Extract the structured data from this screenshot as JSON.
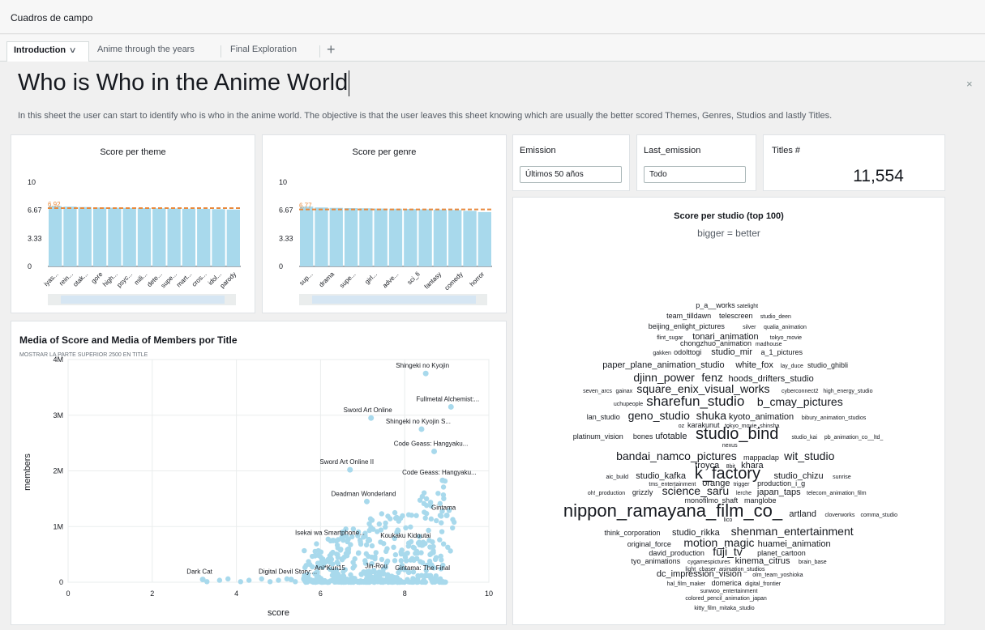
{
  "app": {
    "title": "Cuadros de campo"
  },
  "tabs": [
    {
      "label": "Introduction"
    },
    {
      "label": "Anime through the years"
    },
    {
      "label": "Final Exploration"
    }
  ],
  "sheet": {
    "title": "Who is Who in the Anime World",
    "description": "In this sheet the user can start to identify who is who in the anime world. The objective is that the user leaves this sheet knowing which are usually the better scored Themes, Genres, Studios and lastly Titles."
  },
  "controls": {
    "emission": {
      "label": "Emission",
      "value": "Últimos 50 años"
    },
    "last_emission": {
      "label": "Last_emission",
      "value": "Todo"
    }
  },
  "kpi": {
    "label": "Titles #",
    "value": "11,554"
  },
  "colors": {
    "bar": "#a8d9ec",
    "reference": "#e8893c",
    "point": "#a8d9ec",
    "wordcloud": "#16191f"
  },
  "chart_data": [
    {
      "type": "bar",
      "title": "Score per theme",
      "ylim": [
        0,
        10
      ],
      "yticks": [
        "0",
        "3.33",
        "6.67",
        "10"
      ],
      "reference_label": "6.92",
      "reference_value": 6.92,
      "categories": [
        "iyas...",
        "rein...",
        "otak...",
        "gore",
        "high...",
        "psyc...",
        "mili...",
        "dete...",
        "supe...",
        "mart...",
        "cros...",
        "idol...",
        "parody"
      ],
      "values": [
        7.15,
        7.1,
        7.05,
        7.0,
        6.97,
        6.95,
        6.92,
        6.9,
        6.88,
        6.86,
        6.84,
        6.8,
        6.75
      ],
      "grid": false
    },
    {
      "type": "bar",
      "title": "Score per genre",
      "ylim": [
        0,
        10
      ],
      "yticks": [
        "0",
        "3.33",
        "6.67",
        "10"
      ],
      "reference_label": "6.77",
      "reference_value": 6.77,
      "categories": [
        "sup...",
        "drama",
        "supe...",
        "girl...",
        "adve...",
        "sci_fi",
        "fantasy",
        "comedy",
        "horror"
      ],
      "values": [
        7.1,
        7.0,
        6.95,
        6.92,
        6.9,
        6.87,
        6.85,
        6.82,
        6.78,
        6.75,
        6.7,
        6.6,
        6.45
      ],
      "grid": false
    },
    {
      "type": "scatter",
      "title": "Media of Score and Media of Members por Title",
      "subtitle": "MOSTRAR LA PARTE SUPERIOR 2500 EN TITLE",
      "xlabel": "score",
      "ylabel": "members",
      "xlim": [
        0,
        10
      ],
      "ylim": [
        0,
        4000000
      ],
      "xticks": [
        "0",
        "2",
        "4",
        "6",
        "8",
        "10"
      ],
      "yticks": [
        "0",
        "1M",
        "2M",
        "3M",
        "4M"
      ],
      "labeled_points": [
        {
          "label": "Shingeki no Kyojin",
          "x": 8.5,
          "y": 3750000
        },
        {
          "label": "Fullmetal Alchemist:...",
          "x": 9.1,
          "y": 3150000
        },
        {
          "label": "Sword Art Online",
          "x": 7.2,
          "y": 2950000
        },
        {
          "label": "Shingeki no Kyojin S...",
          "x": 8.4,
          "y": 2750000
        },
        {
          "label": "Code Geass: Hangyaku...",
          "x": 8.7,
          "y": 2350000
        },
        {
          "label": "Sword Art Online II",
          "x": 6.7,
          "y": 2020000
        },
        {
          "label": "Code Geass: Hangyaku...",
          "x": 8.9,
          "y": 1830000
        },
        {
          "label": "Deadman Wonderland",
          "x": 7.1,
          "y": 1450000
        },
        {
          "label": "Gintama",
          "x": 9.0,
          "y": 1200000
        },
        {
          "label": "Isekai wa Smartphone...",
          "x": 6.3,
          "y": 750000
        },
        {
          "label": "Koukaku Kidoutai",
          "x": 8.1,
          "y": 700000
        },
        {
          "label": "Dark Cat",
          "x": 3.2,
          "y": 50000
        },
        {
          "label": "Digital Devil Story:...",
          "x": 5.3,
          "y": 50000
        },
        {
          "label": "Ani*Kuri15",
          "x": 6.3,
          "y": 120000
        },
        {
          "label": "Jin-Rou",
          "x": 7.4,
          "y": 150000
        },
        {
          "label": "Gintama: The Final",
          "x": 8.5,
          "y": 120000
        }
      ],
      "grid": true
    },
    {
      "type": "wordcloud",
      "title": "Score per studio (top 100)",
      "subtitle": "bigger = better",
      "words": [
        {
          "text": "p_a__works",
          "w": 1
        },
        {
          "text": "satelight",
          "w": 0
        },
        {
          "text": "team_tilldawn",
          "w": 1
        },
        {
          "text": "telescreen",
          "w": 1
        },
        {
          "text": "studio_deen",
          "w": 0
        },
        {
          "text": "beijing_enlight_pictures",
          "w": 1
        },
        {
          "text": "silver",
          "w": 0
        },
        {
          "text": "qualia_animation",
          "w": 0
        },
        {
          "text": "flint_sugar",
          "w": 0
        },
        {
          "text": "tonari_animation",
          "w": 2
        },
        {
          "text": "tokyo_movie",
          "w": 0
        },
        {
          "text": "chongzhuo_animation",
          "w": 1
        },
        {
          "text": "madhouse",
          "w": 0
        },
        {
          "text": "gakken",
          "w": 0
        },
        {
          "text": "odolttogi",
          "w": 1
        },
        {
          "text": "studio_mir",
          "w": 2
        },
        {
          "text": "a_1_pictures",
          "w": 1
        },
        {
          "text": "paper_plane_animation_studio",
          "w": 2
        },
        {
          "text": "white_fox",
          "w": 2
        },
        {
          "text": "lay_duce",
          "w": 0
        },
        {
          "text": "studio_ghibli",
          "w": 1
        },
        {
          "text": "djinn_power",
          "w": 3
        },
        {
          "text": "fenz",
          "w": 3
        },
        {
          "text": "hoods_drifters_studio",
          "w": 2
        },
        {
          "text": "seven_arcs",
          "w": 0
        },
        {
          "text": "gainax",
          "w": 0
        },
        {
          "text": "square_enix_visual_works",
          "w": 3
        },
        {
          "text": "cyberconnect2",
          "w": 0
        },
        {
          "text": "high_energy_studio",
          "w": 0
        },
        {
          "text": "uchupeople",
          "w": 0
        },
        {
          "text": "sharefun_studio",
          "w": 4
        },
        {
          "text": "b_cmay_pictures",
          "w": 3
        },
        {
          "text": "lan_studio",
          "w": 1
        },
        {
          "text": "geno_studio",
          "w": 3
        },
        {
          "text": "shuka",
          "w": 3
        },
        {
          "text": "kyoto_animation",
          "w": 2
        },
        {
          "text": "bibury_animation_studios",
          "w": 0
        },
        {
          "text": "oz",
          "w": 0
        },
        {
          "text": "karakunut",
          "w": 1
        },
        {
          "text": "tokyo_movie_shinsha",
          "w": 0
        },
        {
          "text": "platinum_vision",
          "w": 1
        },
        {
          "text": "bones",
          "w": 1
        },
        {
          "text": "ufotable",
          "w": 2
        },
        {
          "text": "studio_bind",
          "w": 5
        },
        {
          "text": "studio_kai",
          "w": 0
        },
        {
          "text": "pb_animation_co__ltd_",
          "w": 0
        },
        {
          "text": "nexus",
          "w": 0
        },
        {
          "text": "bandai_namco_pictures",
          "w": 3
        },
        {
          "text": "mappa",
          "w": 1
        },
        {
          "text": "clap",
          "w": 1
        },
        {
          "text": "wit_studio",
          "w": 3
        },
        {
          "text": "troyca",
          "w": 2
        },
        {
          "text": "8bit",
          "w": 0
        },
        {
          "text": "khara",
          "w": 2
        },
        {
          "text": "aic_build",
          "w": 0
        },
        {
          "text": "studio_kafka",
          "w": 2
        },
        {
          "text": "k_factory",
          "w": 5
        },
        {
          "text": "studio_chizu",
          "w": 2
        },
        {
          "text": "sunrise",
          "w": 0
        },
        {
          "text": "tms_entertainment",
          "w": 0
        },
        {
          "text": "orange",
          "w": 2
        },
        {
          "text": "trigger",
          "w": 0
        },
        {
          "text": "production_i_g",
          "w": 1
        },
        {
          "text": "oh!_production",
          "w": 0
        },
        {
          "text": "grizzly",
          "w": 1
        },
        {
          "text": "science_saru",
          "w": 3
        },
        {
          "text": "lerche",
          "w": 0
        },
        {
          "text": "japan_taps",
          "w": 2
        },
        {
          "text": "telecom_animation_film",
          "w": 0
        },
        {
          "text": "monofilmo",
          "w": 1
        },
        {
          "text": "shaft",
          "w": 1
        },
        {
          "text": "manglobe",
          "w": 1
        },
        {
          "text": "nippon_ramayana_film_co_",
          "w": 6
        },
        {
          "text": "artland",
          "w": 2
        },
        {
          "text": "cloverworks",
          "w": 0
        },
        {
          "text": "comma_studio",
          "w": 0
        },
        {
          "text": "lico",
          "w": 0
        },
        {
          "text": "think_corporation",
          "w": 1
        },
        {
          "text": "studio_rikka",
          "w": 2
        },
        {
          "text": "shenman_entertainment",
          "w": 3
        },
        {
          "text": "original_force",
          "w": 1
        },
        {
          "text": "motion_magic",
          "w": 3
        },
        {
          "text": "huamei_animation",
          "w": 2
        },
        {
          "text": "david_production",
          "w": 1
        },
        {
          "text": "fuji_tv",
          "w": 3
        },
        {
          "text": "planet_cartoon",
          "w": 1
        },
        {
          "text": "tyo_animations",
          "w": 1
        },
        {
          "text": "cygamespictures",
          "w": 0
        },
        {
          "text": "kinema_citrus",
          "w": 2
        },
        {
          "text": "brain_base",
          "w": 0
        },
        {
          "text": "light_chaser_animation_studios",
          "w": 0
        },
        {
          "text": "dc_impression_vision",
          "w": 2
        },
        {
          "text": "olm_team_yoshioka",
          "w": 0
        },
        {
          "text": "hal_film_maker",
          "w": 0
        },
        {
          "text": "domerica",
          "w": 1
        },
        {
          "text": "digital_frontier",
          "w": 0
        },
        {
          "text": "sunwoo_entertainment",
          "w": 0
        },
        {
          "text": "colored_pencil_animation_japan",
          "w": 0
        },
        {
          "text": "kitty_film_mitaka_studio",
          "w": 0
        }
      ]
    }
  ]
}
